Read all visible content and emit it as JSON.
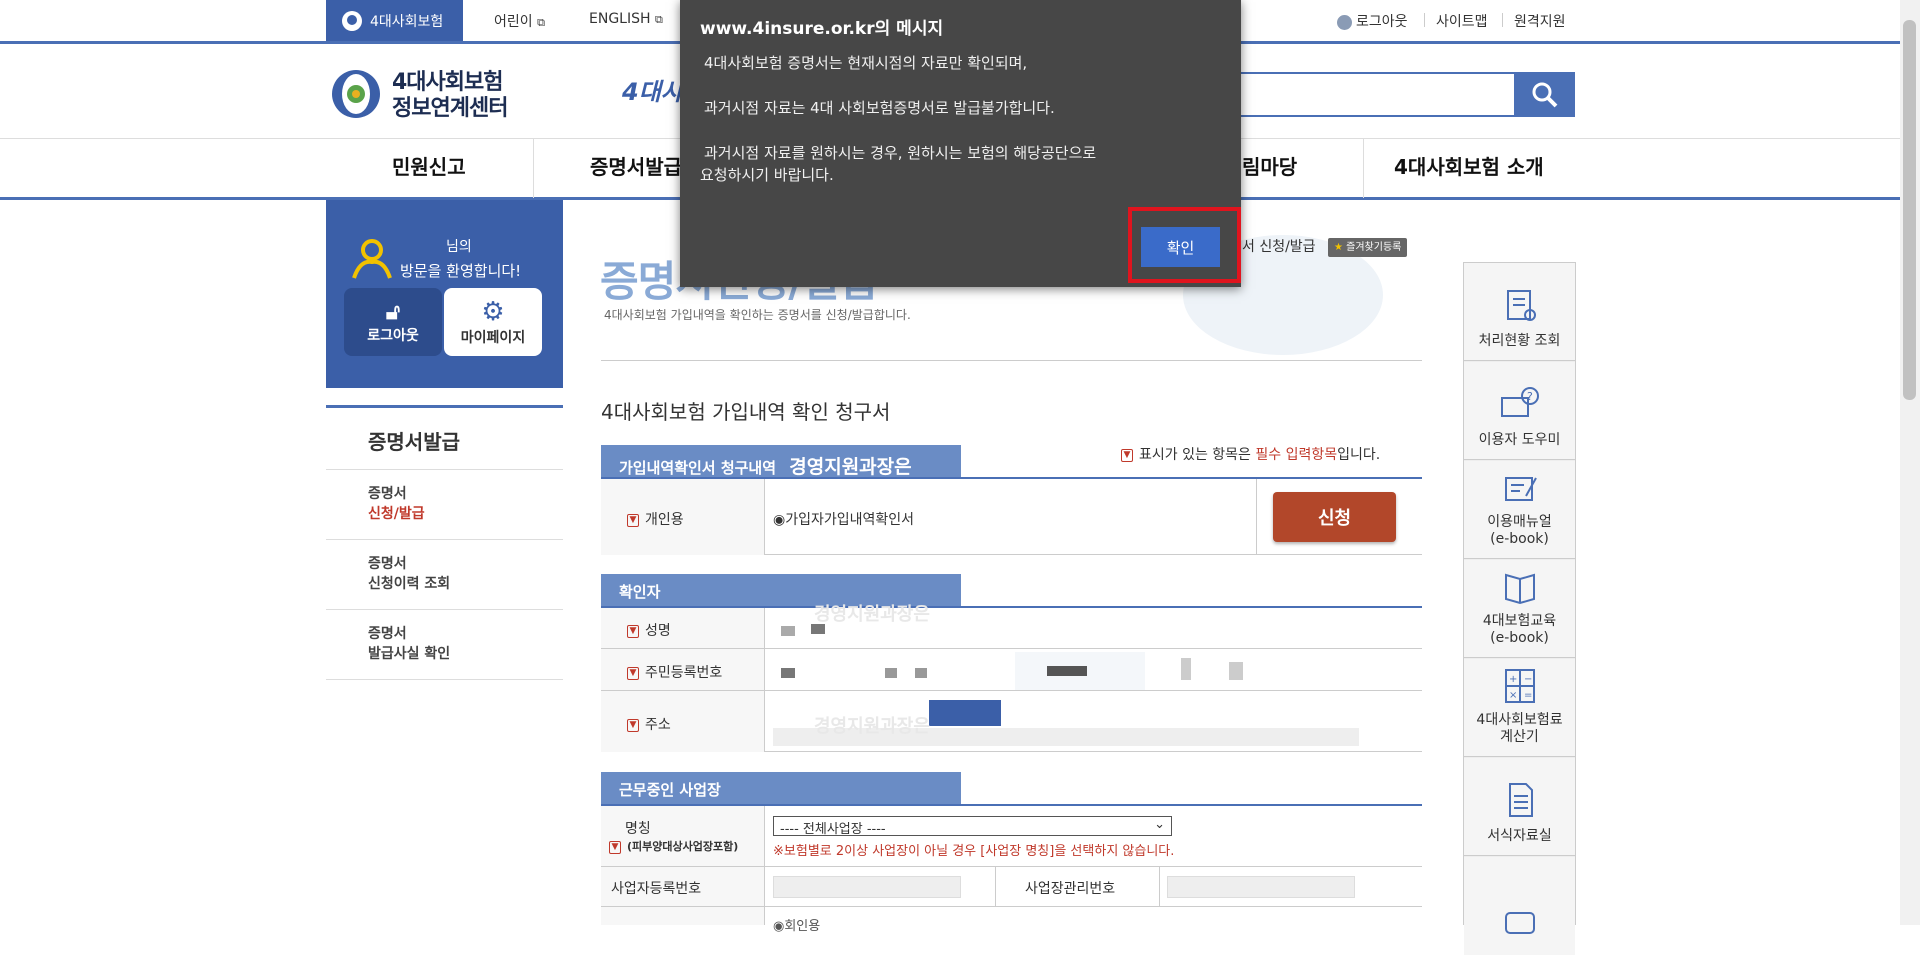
{
  "topbar": {
    "brand_tab": "4대사회보험",
    "links": [
      "어린이",
      "ENGLISH"
    ],
    "right_links": [
      "로그아웃",
      "사이트맵",
      "원격지원"
    ]
  },
  "header": {
    "logo_line1": "4대사회보험",
    "logo_line2": "정보연계센터",
    "partial_text": "4대사"
  },
  "nav": {
    "items": [
      "민원신고",
      "증명서발급",
      "림마당",
      "4대사회보험 소개"
    ]
  },
  "sidebar": {
    "welcome_line1": "님의",
    "welcome_line2": "방문을 환영합니다!",
    "logout_label": "로그아웃",
    "mypage_label": "마이페이지",
    "menu_title": "증명서발급",
    "items": [
      {
        "line1": "증명서",
        "line2": "신청/발급"
      },
      {
        "line1": "증명서",
        "line2": "신청이력 조회"
      },
      {
        "line1": "증명서",
        "line2": "발급사실 확인"
      }
    ]
  },
  "main": {
    "page_title": "증명서신청/발급",
    "page_subtitle": "4대사회보험 가입내역을 확인하는 증명서를 신청/발급합니다.",
    "breadcrumb_tail": "서 신청/발급",
    "favorite_label": "즐겨찾기등록",
    "form_title": "4대사회보험 가입내역 확인 청구서",
    "required_note_prefix": "표시가 있는 항목은 ",
    "required_note_red": "필수 입력항목",
    "required_note_suffix": "입니다.",
    "section1": "가입내역확인서 청구내역",
    "overlay_text": "경영지원과장은",
    "personal_label": "개인용",
    "radio_label": "◉가입자가입내역확인서",
    "apply_button": "신청",
    "section2": "확인자",
    "name_label": "성명",
    "rrn_label": "주민등록번호",
    "address_label": "주소",
    "section3": "근무중인 사업장",
    "company_label": "명칭",
    "company_sublabel": "(피부양대상사업장포함)",
    "company_select": "---- 전체사업장 ----",
    "company_warning": "※보험별로 2이상 사업장이 아닐 경우 [사업장 명칭]을 선택하지 않습니다.",
    "bizno_label": "사업자등록번호",
    "mgmtno_label": "사업장관리번호",
    "bottom_partial": "◉회인용"
  },
  "right_panel": {
    "items": [
      {
        "label": "처리현황 조회",
        "icon": "clipboard-search-icon"
      },
      {
        "label": "이용자 도우미",
        "icon": "help-monitor-icon"
      },
      {
        "label": "이용매뉴얼\n(e-book)",
        "icon": "manual-icon"
      },
      {
        "label": "4대보험교육\n(e-book)",
        "icon": "book-icon"
      },
      {
        "label": "4대사회보험료\n계산기",
        "icon": "calculator-icon"
      },
      {
        "label": "서식자료실",
        "icon": "document-icon"
      }
    ]
  },
  "dialog": {
    "title": "www.4insure.or.kr의 메시지",
    "line1": "4대사회보험 증명서는  현재시점의 자료만 확인되며,",
    "line2": "과거시점 자료는 4대 사회보험증명서로 발급불가합니다.",
    "line3": "과거시점 자료를 원하시는 경우, 원하시는 보험의 해당공단으로",
    "line4": "요청하시기 바랍니다.",
    "ok_label": "확인"
  },
  "colors": {
    "brand_blue": "#3b5fa8",
    "apply_button": "#b2472a",
    "dialog_bg": "#474747",
    "highlight_red": "#e0141e"
  }
}
